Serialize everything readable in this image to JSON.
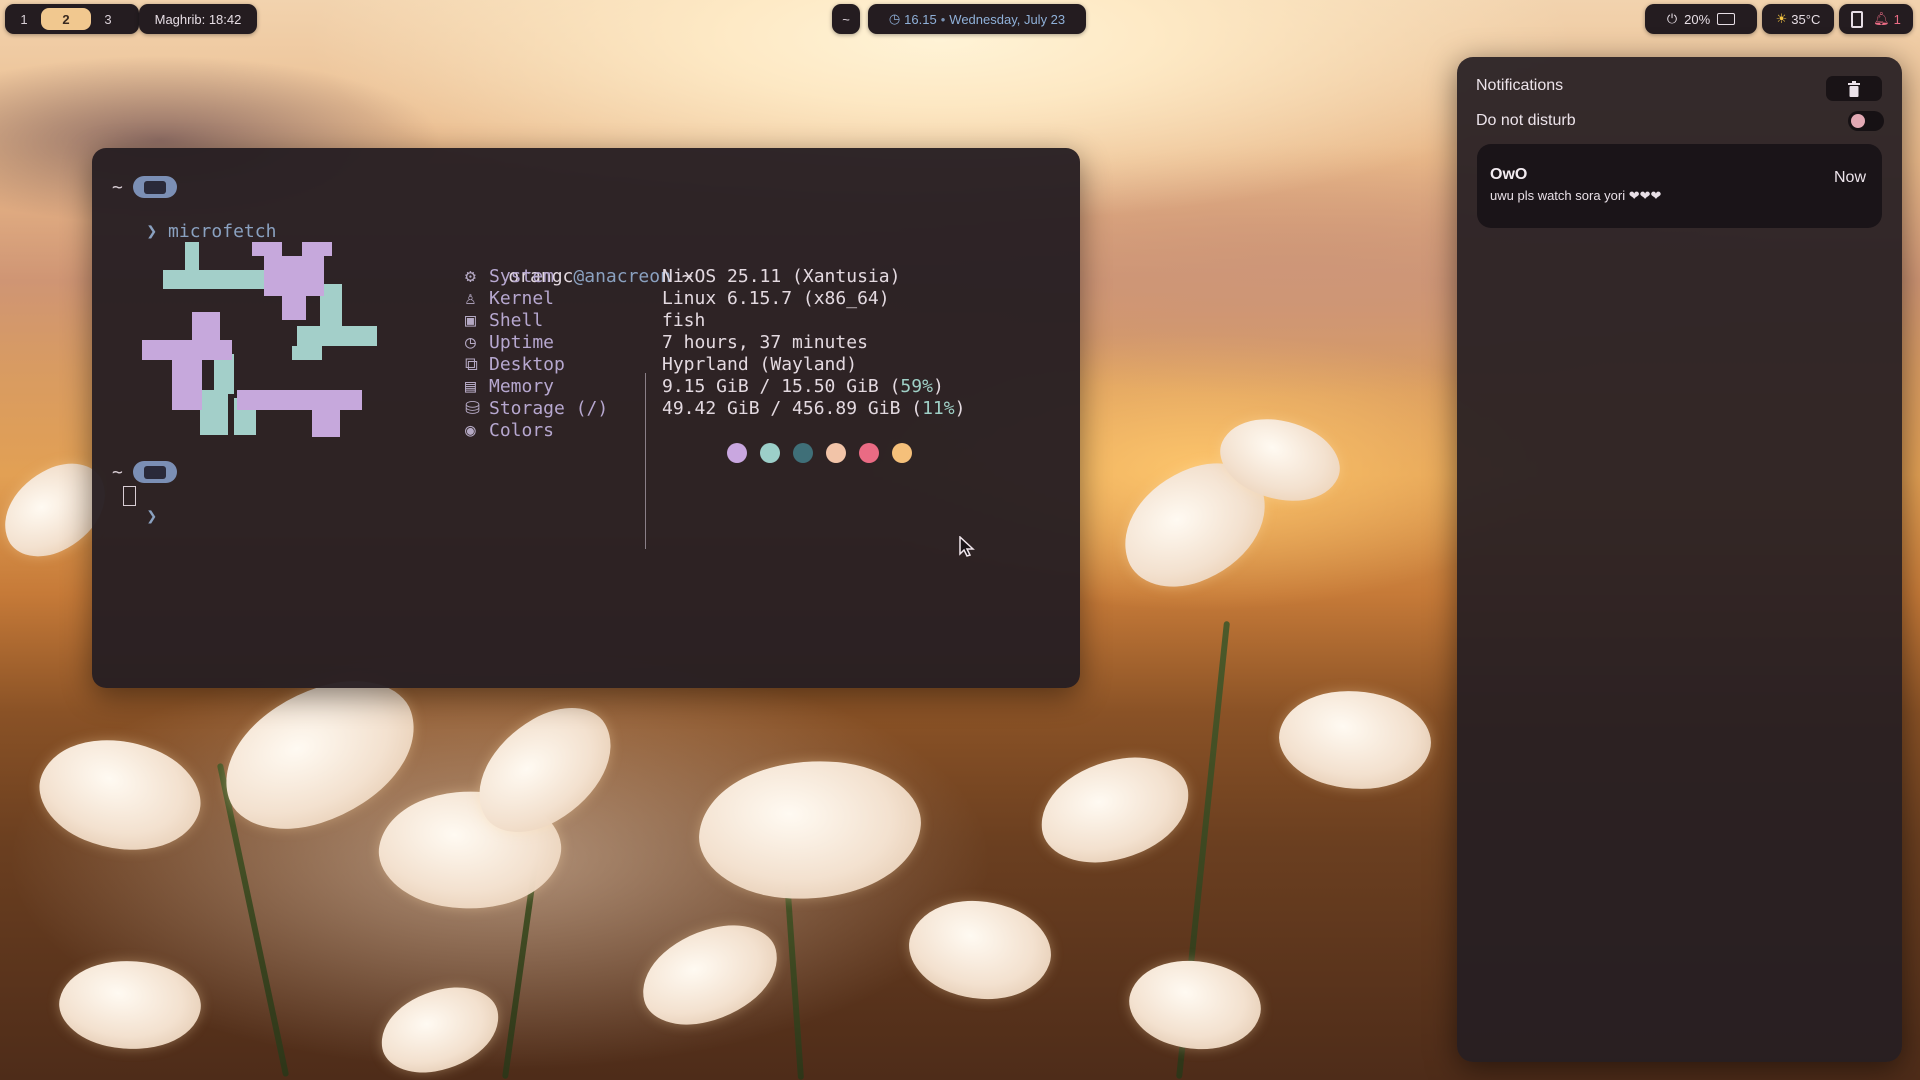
{
  "topbar": {
    "workspaces": [
      "1",
      "2",
      "3"
    ],
    "active_workspace": "2",
    "prayer": "Maghrib: 18:42",
    "launcher": "~",
    "time": "16.15",
    "date_sep": "•",
    "date": "Wednesday, July 23",
    "battery": "20%",
    "weather": "35°C",
    "notif_count": "1"
  },
  "terminal": {
    "prompt_dir": "~",
    "prompt_symbol": "❯",
    "command": "microfetch",
    "user": "orangc",
    "at": "@",
    "host": "anacreon",
    "host_suffix": " ~",
    "fields": [
      {
        "icon": "⚙",
        "label": "System",
        "value": "NixOS 25.11 (Xantusia)"
      },
      {
        "icon": "♙",
        "label": "Kernel",
        "value": "Linux 6.15.7 (x86_64)"
      },
      {
        "icon": "▣",
        "label": "Shell",
        "value": "fish"
      },
      {
        "icon": "◷",
        "label": "Uptime",
        "value": "7 hours, 37 minutes"
      },
      {
        "icon": "⧉",
        "label": "Desktop",
        "value": "Hyprland (Wayland)"
      },
      {
        "icon": "▤",
        "label": "Memory",
        "value": "9.15 GiB / 15.50 GiB (",
        "pct": "59%",
        "tail": ")"
      },
      {
        "icon": "⛁",
        "label": "Storage (/)",
        "value": "49.42 GiB / 456.89 GiB (",
        "pct": "11%",
        "tail": ")"
      },
      {
        "icon": "◉",
        "label": "Colors",
        "value": ""
      }
    ],
    "colors": [
      "#c9a7e0",
      "#9ccfc9",
      "#3f6f78",
      "#f2c4a8",
      "#ea6b84",
      "#f5c07a"
    ]
  },
  "notifications": {
    "title": "Notifications",
    "dnd_label": "Do not disturb",
    "items": [
      {
        "app": "OwO",
        "body": "uwu pls watch sora yori ❤❤❤",
        "time": "Now"
      }
    ]
  }
}
